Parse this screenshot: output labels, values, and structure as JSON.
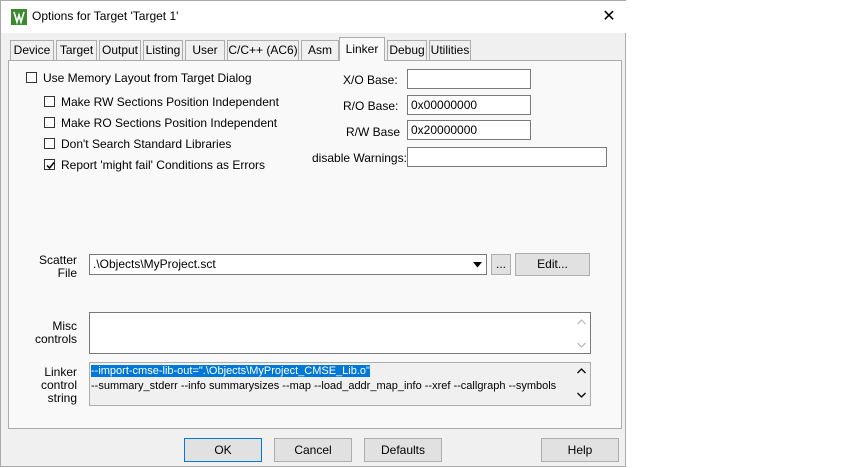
{
  "window": {
    "title": "Options for Target 'Target 1'",
    "close_glyph": "✕"
  },
  "tabs": [
    {
      "label": "Device"
    },
    {
      "label": "Target"
    },
    {
      "label": "Output"
    },
    {
      "label": "Listing"
    },
    {
      "label": "User"
    },
    {
      "label": "C/C++ (AC6)"
    },
    {
      "label": "Asm"
    },
    {
      "label": "Linker",
      "active": true
    },
    {
      "label": "Debug"
    },
    {
      "label": "Utilities"
    }
  ],
  "options": {
    "use_memory_layout": {
      "label": "Use Memory Layout from Target Dialog",
      "checked": false
    },
    "rw_position_independent": {
      "label": "Make RW Sections Position Independent",
      "checked": false
    },
    "ro_position_independent": {
      "label": "Make RO Sections Position Independent",
      "checked": false
    },
    "dont_search_std_libs": {
      "label": "Don't Search Standard Libraries",
      "checked": false
    },
    "report_might_fail": {
      "label": "Report 'might fail' Conditions as Errors",
      "checked": true
    }
  },
  "base": {
    "xo_label": "X/O Base:",
    "xo_value": "",
    "ro_label": "R/O Base:",
    "ro_value": "0x00000000",
    "rw_label": "R/W Base",
    "rw_value": "0x20000000",
    "warnings_label": "disable Warnings:",
    "warnings_value": ""
  },
  "scatter": {
    "label_line1": "Scatter",
    "label_line2": "File",
    "value": ".\\Objects\\MyProject.sct",
    "browse_label": "...",
    "edit_label": "Edit..."
  },
  "misc": {
    "label_line1": "Misc",
    "label_line2": "controls",
    "value": ""
  },
  "linker_control": {
    "label_line1": "Linker",
    "label_line2": "control",
    "label_line3": "string",
    "line1": "--import-cmse-lib-out=\".\\Objects\\MyProject_CMSE_Lib.o\"",
    "line2": "--summary_stderr --info summarysizes --map --load_addr_map_info --xref --callgraph --symbols"
  },
  "buttons": {
    "ok": "OK",
    "cancel": "Cancel",
    "defaults": "Defaults",
    "help": "Help"
  },
  "colors": {
    "dialog_bg": "#f0f0f0",
    "panel_bg": "#f9f9f9",
    "selection": "#0078d7",
    "app_icon": "#3a8a2e"
  }
}
